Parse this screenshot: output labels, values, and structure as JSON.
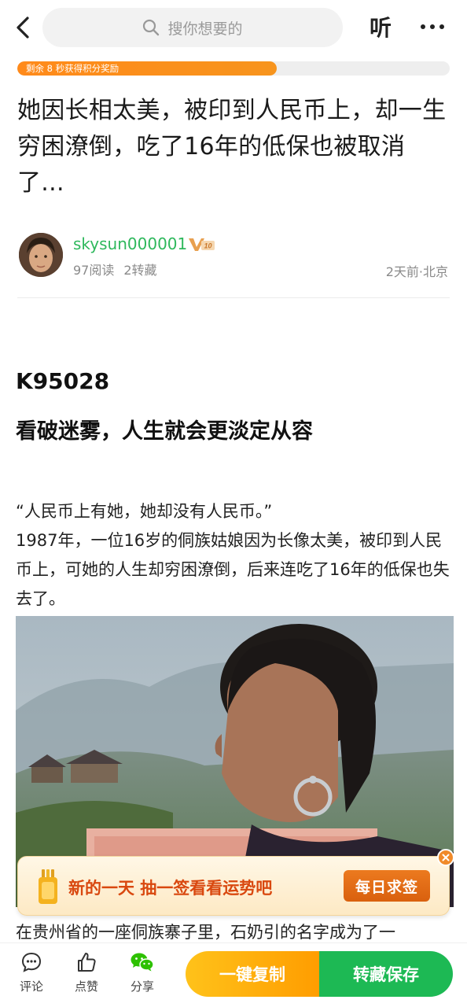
{
  "header": {
    "search_placeholder": "搜你想要的",
    "listen_label": "听"
  },
  "reward_progress": {
    "text": "剩余 8 秒获得积分奖励",
    "fraction": 0.6
  },
  "article": {
    "title": "她因长相太美，被印到人民币上，却一生穷困潦倒，吃了16年的低保也被取消了...",
    "author": {
      "name": "skysun000001",
      "level_badge": "V10",
      "reads": "97阅读",
      "reposts": "2转藏",
      "time_location": "2天前·北京"
    },
    "code": "K95028",
    "subtitle": "看破迷雾，人生就会更淡定从容",
    "para1_line1": "“人民币上有她，她却没有人民币。”",
    "para1_line2": "1987年，一位16岁的侗族姑娘因为长像太美，被印到人民币上，可她的人生却穷困潦倒，后来连吃了16年的低保也失去了。",
    "para2": "在贵州省的一座侗族寨子里，石奶引的名字成为了一"
  },
  "promo_banner": {
    "text": "新的一天 抽一签看看运势吧",
    "button_label": "每日求签"
  },
  "bottom_bar": {
    "comment_label": "评论",
    "like_label": "点赞",
    "share_label": "分享",
    "copy_label": "一键复制",
    "save_label": "转藏保存"
  },
  "colors": {
    "accent_green": "#1db954",
    "accent_orange": "#ff9d00",
    "author_name": "#2eb85c"
  }
}
